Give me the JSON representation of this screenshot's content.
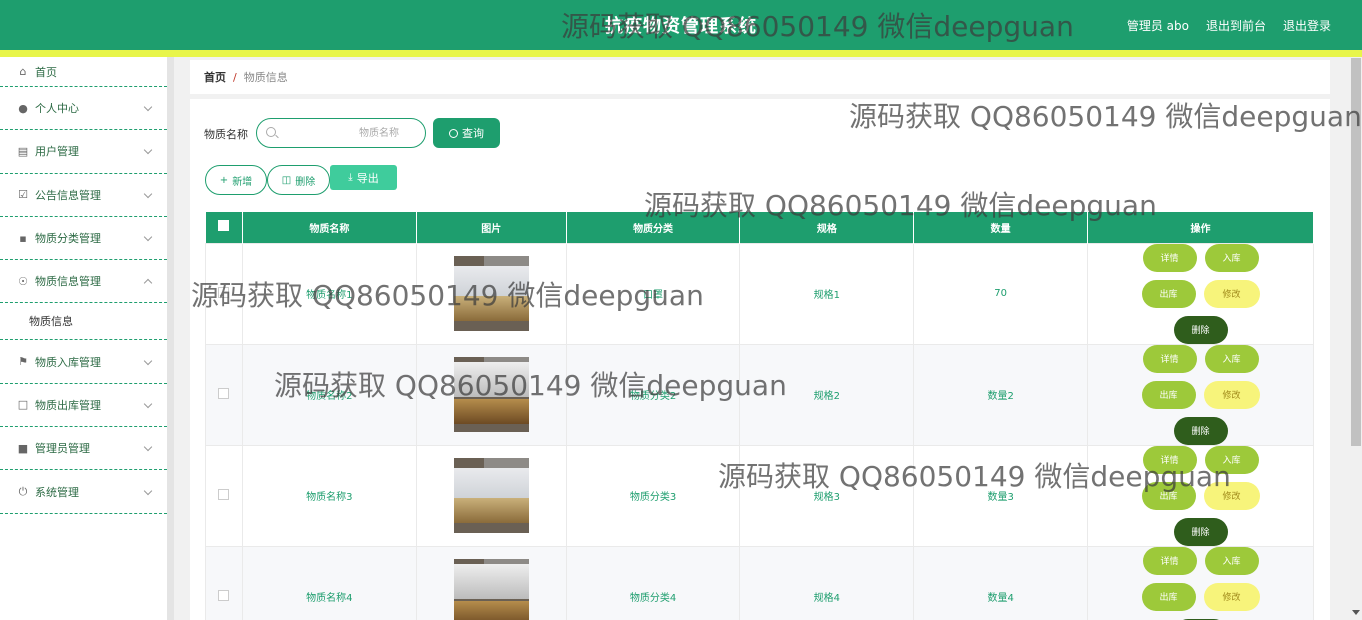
{
  "header": {
    "title": "抗疫物资管理系统",
    "links": [
      "管理员 abo",
      "退出到前台",
      "退出登录"
    ]
  },
  "sidebar": {
    "items": [
      {
        "label": "首页",
        "icon": "home-icon"
      },
      {
        "label": "个人中心",
        "icon": "user-icon"
      },
      {
        "label": "用户管理",
        "icon": "chart-icon"
      },
      {
        "label": "公告信息管理",
        "icon": "clipboard-icon"
      },
      {
        "label": "物质分类管理",
        "icon": "briefcase-icon"
      },
      {
        "label": "物质信息管理",
        "icon": "compass-icon"
      },
      {
        "label": "物质入库管理",
        "icon": "flag-icon"
      },
      {
        "label": "物质出库管理",
        "icon": "chat-icon"
      },
      {
        "label": "管理员管理",
        "icon": "stamp-icon"
      },
      {
        "label": "系统管理",
        "icon": "power-icon"
      }
    ],
    "sub_item": "物质信息"
  },
  "breadcrumb": {
    "home": "首页",
    "separator": "/",
    "current": "物质信息"
  },
  "search": {
    "label": "物质名称",
    "placeholder": "物质名称",
    "button": "查询"
  },
  "actions": {
    "add": "新增",
    "delete": "删除",
    "export": "导出"
  },
  "table": {
    "columns": [
      "物质名称",
      "图片",
      "物质分类",
      "规格",
      "数量",
      "操作"
    ],
    "rows": [
      {
        "name": "物质名称1",
        "category": "口罩",
        "spec": "规格1",
        "qty": "70"
      },
      {
        "name": "物质名称2",
        "category": "物质分类2",
        "spec": "规格2",
        "qty": "数量2"
      },
      {
        "name": "物质名称3",
        "category": "物质分类3",
        "spec": "规格3",
        "qty": "数量3"
      },
      {
        "name": "物质名称4",
        "category": "物质分类4",
        "spec": "规格4",
        "qty": "数量4"
      }
    ],
    "ops": {
      "detail": "详情",
      "in": "入库",
      "out": "出库",
      "edit": "修改",
      "delete": "删除"
    }
  },
  "watermark": "源码获取 QQ86050149 微信deepguan",
  "colors": {
    "primary": "#1e9e6e",
    "accent_bar": "#e8f54a",
    "op_green": "#9dc93a",
    "op_yellow": "#f7f47b",
    "op_dark": "#2f5d1c"
  }
}
